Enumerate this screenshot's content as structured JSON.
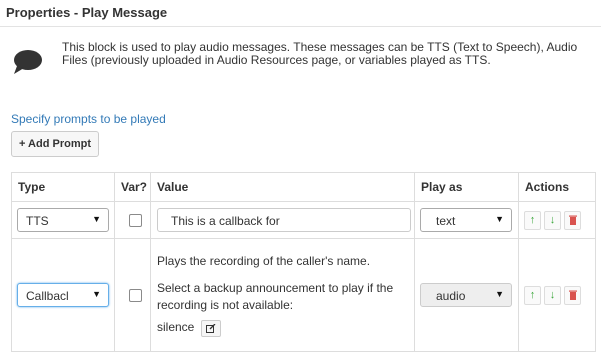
{
  "panel": {
    "title": "Properties - Play Message"
  },
  "info": {
    "icon": "speech-bubble-icon",
    "description": "This block is used to play audio messages. These messages can be TTS (Text to Speech), Audio Files (previously uploaded in Audio Resources page, or variables played as TTS."
  },
  "prompts": {
    "section_label": "Specify prompts to be played",
    "add_button": "+ Add Prompt",
    "columns": {
      "type": "Type",
      "var": "Var?",
      "value": "Value",
      "play_as": "Play as",
      "actions": "Actions"
    },
    "rows": [
      {
        "type": "TTS",
        "var_checked": false,
        "value": "This is a callback for",
        "play_as": "text"
      },
      {
        "type": "Callbacl",
        "var_checked": false,
        "value_line1": "Plays the recording of the caller's name.",
        "value_line2": "Select a backup announcement to play if the recording is not available:",
        "backup_value": "silence",
        "play_as": "audio"
      }
    ]
  },
  "icons": {
    "up": "arrow-up-icon",
    "down": "arrow-down-icon",
    "delete": "trash-icon",
    "edit": "edit-icon"
  },
  "colors": {
    "link": "#337ab7",
    "up_down": "#3aa63a",
    "delete": "#d9534f"
  }
}
